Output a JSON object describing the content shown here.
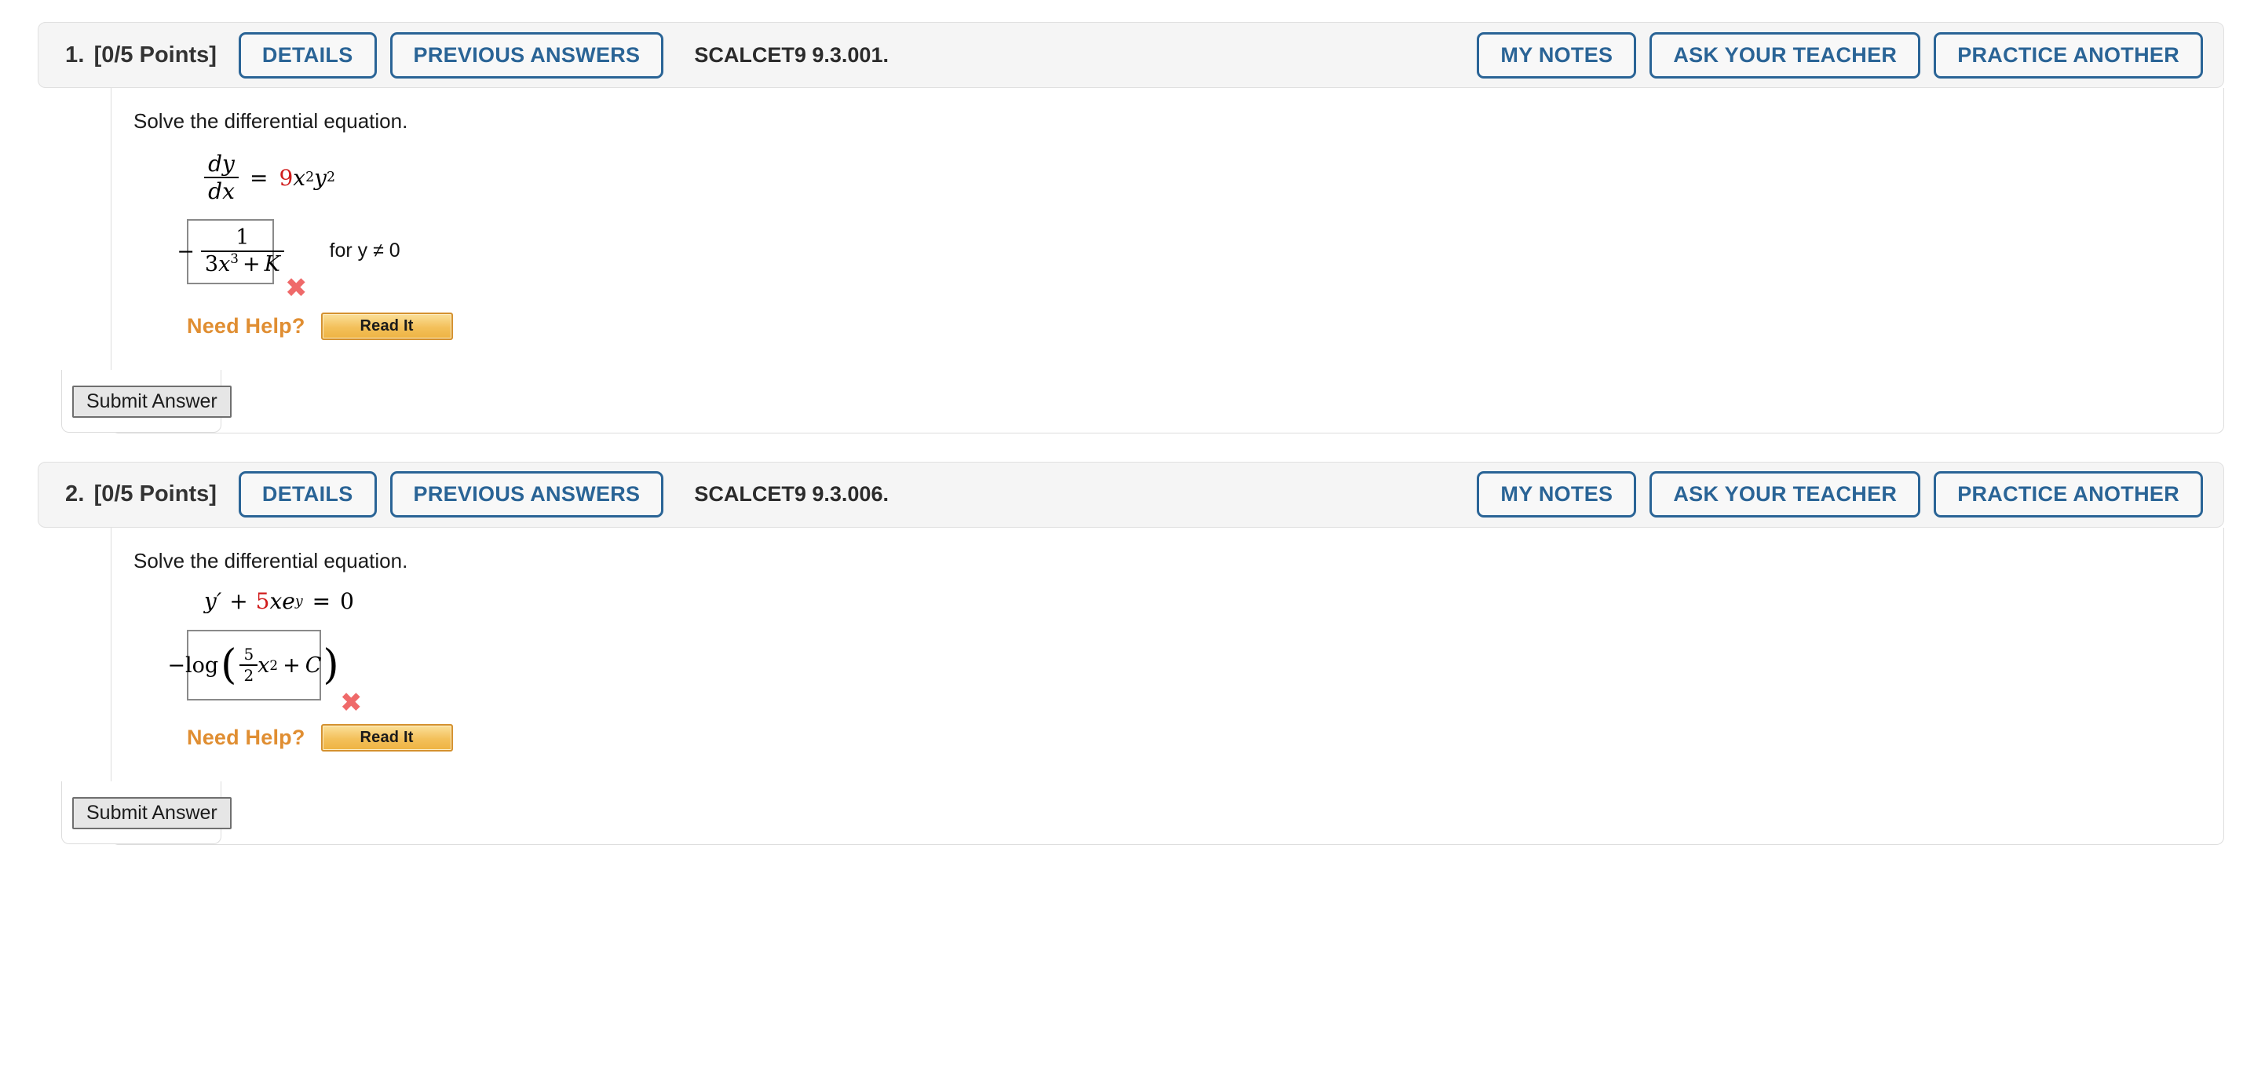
{
  "page": {
    "background": "#ffffff",
    "accent_blue": "#2a6496",
    "accent_orange": "#e08e32",
    "error_red": "#ef6a6a",
    "highlight_red": "#d01c1c"
  },
  "buttons": {
    "details": "DETAILS",
    "previous_answers": "PREVIOUS ANSWERS",
    "my_notes": "MY NOTES",
    "ask_your_teacher": "ASK YOUR TEACHER",
    "practice_another": "PRACTICE ANOTHER",
    "read_it": "Read It",
    "submit_answer": "Submit Answer"
  },
  "labels": {
    "need_help": "Need Help?",
    "prompt": "Solve the differential equation."
  },
  "questions": [
    {
      "number": "1.",
      "points": "[0/5 Points]",
      "code": "SCALCET9 9.3.001.",
      "prompt": "Solve the differential equation.",
      "equation": {
        "lhs_numerator": "dy",
        "lhs_denominator": "dx",
        "equals": "=",
        "coefficient": "9",
        "rhs_base1": "x",
        "rhs_exp1": "2",
        "rhs_base2": "y",
        "rhs_exp2": "2"
      },
      "answer": {
        "minus": "−",
        "numerator": "1",
        "den_coef": "3",
        "den_var": "x",
        "den_exp": "3",
        "den_plus": "+",
        "den_const": "K"
      },
      "condition": "for y ≠ 0",
      "mark": "✖",
      "mark_status": "incorrect",
      "need_help": "Need Help?",
      "read_it": "Read It",
      "submit": "Submit Answer"
    },
    {
      "number": "2.",
      "points": "[0/5 Points]",
      "code": "SCALCET9 9.3.006.",
      "prompt": "Solve the differential equation.",
      "equation": {
        "y_prime": "y′",
        "plus": "+",
        "coefficient": "5",
        "var_x": "x",
        "base_e": "e",
        "exp_y": "y",
        "equals": "=",
        "rhs": "0"
      },
      "answer": {
        "minus_log": "−log",
        "paren_open": "(",
        "frac_num": "5",
        "frac_den": "2",
        "var_x": "x",
        "exp": "2",
        "plus": "+",
        "const": "C",
        "paren_close": ")"
      },
      "condition": "",
      "mark": "✖",
      "mark_status": "incorrect",
      "need_help": "Need Help?",
      "read_it": "Read It",
      "submit": "Submit Answer"
    }
  ]
}
